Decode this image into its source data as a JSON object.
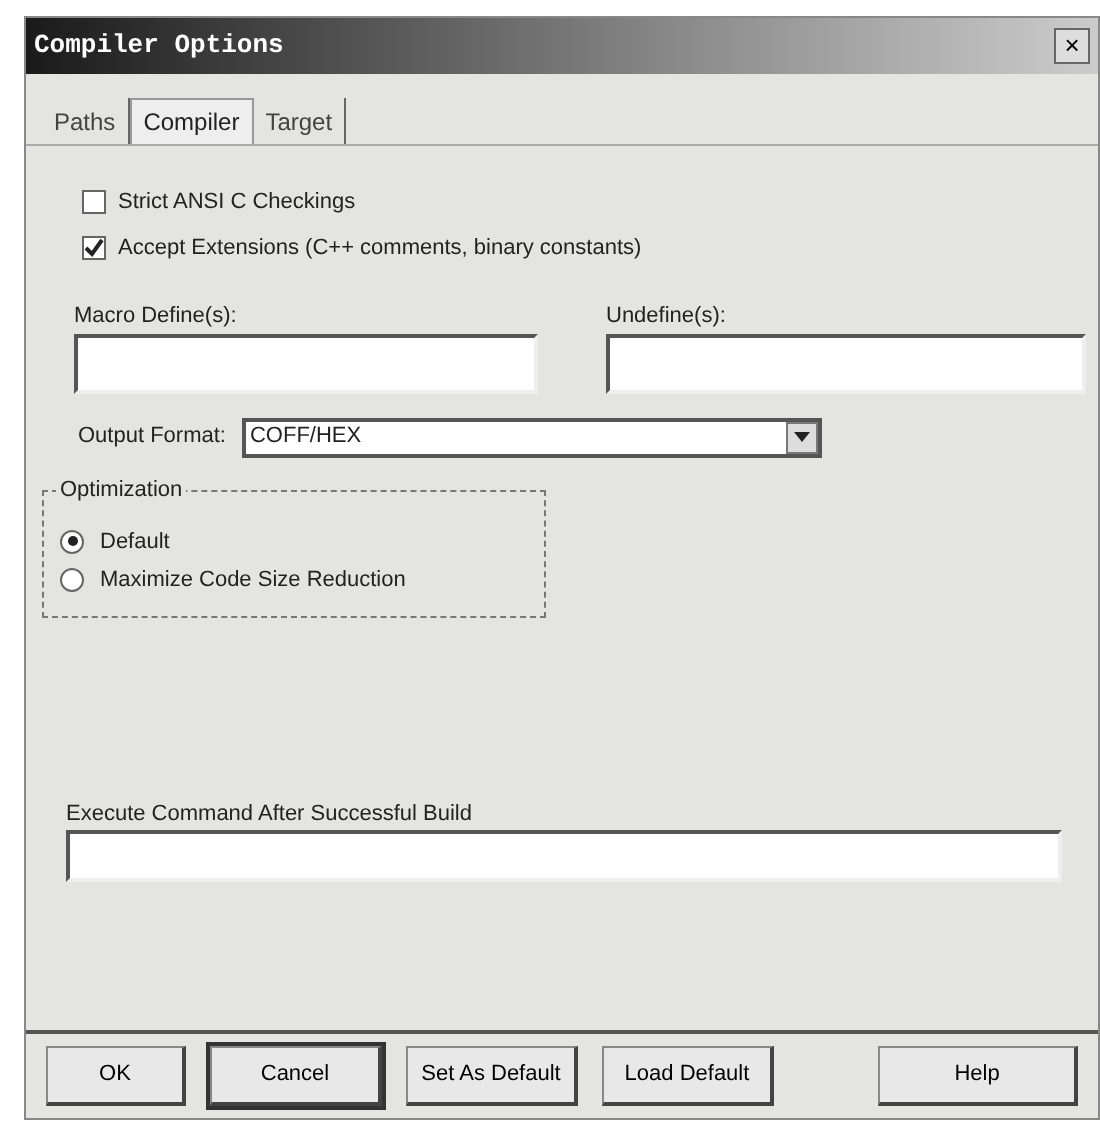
{
  "window": {
    "title": "Compiler Options",
    "close": "×"
  },
  "tabs": [
    {
      "label": "Paths",
      "selected": false
    },
    {
      "label": "Compiler",
      "selected": true
    },
    {
      "label": "Target",
      "selected": false
    }
  ],
  "checkboxes": [
    {
      "label": "Strict ANSI C Checkings",
      "checked": false
    },
    {
      "label": "Accept Extensions (C++ comments, binary constants)",
      "checked": true
    }
  ],
  "define_fields": [
    {
      "label": "Macro Define(s):"
    },
    {
      "label": "Undefine(s):"
    }
  ],
  "output_format": {
    "label": "Output Format:",
    "value": "COFF/HEX"
  },
  "optimization": {
    "title": "Optimization",
    "options": [
      {
        "label": "Default",
        "selected": true
      },
      {
        "label": "Maximize Code Size Reduction",
        "selected": false
      }
    ]
  },
  "execute_command": {
    "label": "Execute Command After Successful Build"
  },
  "buttons": [
    {
      "label": "OK",
      "focused": false
    },
    {
      "label": "Cancel",
      "focused": true
    },
    {
      "label": "Set As Default",
      "focused": false
    },
    {
      "label": "Load Default",
      "focused": false
    },
    {
      "label": "Help",
      "focused": false
    }
  ]
}
